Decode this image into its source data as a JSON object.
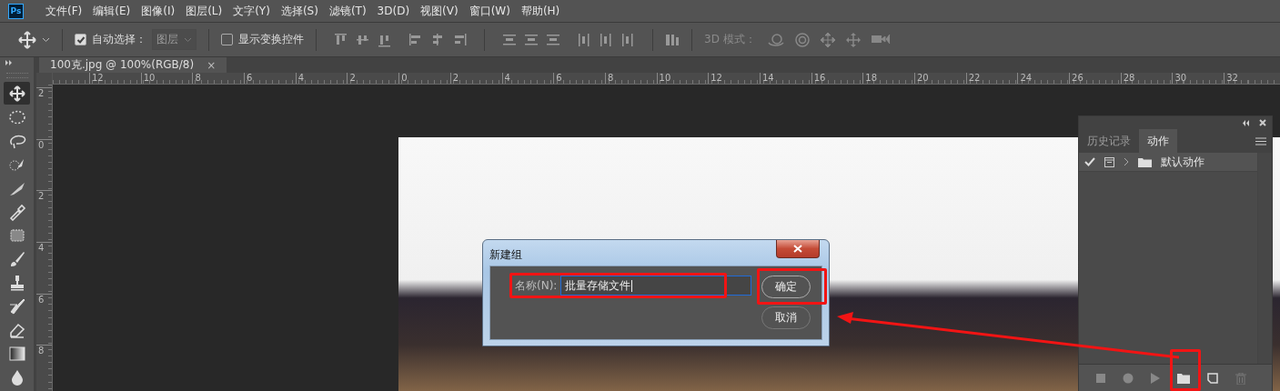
{
  "app_logo": "Ps",
  "menu": [
    "文件(F)",
    "编辑(E)",
    "图像(I)",
    "图层(L)",
    "文字(Y)",
    "选择(S)",
    "滤镜(T)",
    "3D(D)",
    "视图(V)",
    "窗口(W)",
    "帮助(H)"
  ],
  "options_bar": {
    "auto_select": {
      "label": "自动选择：",
      "checked": true
    },
    "target_dropdown": {
      "value": "图层",
      "disabled": true
    },
    "show_transform": {
      "label": "显示变换控件",
      "checked": false
    },
    "mode_label": "3D 模式："
  },
  "document_tab": {
    "title": "100克.jpg @ 100%(RGB/8)",
    "close": "×"
  },
  "tools": [
    {
      "selected": true
    },
    {
      "selected": false
    },
    {
      "selected": false
    },
    {
      "selected": false
    },
    {
      "selected": false
    },
    {
      "selected": false
    },
    {
      "selected": false
    },
    {
      "selected": false
    },
    {
      "selected": false
    },
    {
      "selected": false
    },
    {
      "selected": false
    },
    {
      "selected": false
    },
    {
      "selected": false
    }
  ],
  "rulers": {
    "horizontal": [
      "12",
      "10",
      "8",
      "6",
      "4",
      "2",
      "0",
      "2",
      "4",
      "6",
      "8",
      "10",
      "12",
      "14",
      "16",
      "18",
      "20",
      "22",
      "24",
      "26",
      "28",
      "30",
      "32"
    ],
    "vertical": [
      "2",
      "0",
      "2",
      "4",
      "6",
      "8"
    ]
  },
  "dialog": {
    "title": "新建组",
    "name_label": "名称(N):",
    "name_value": "批量存储文件",
    "buttons": [
      "确定",
      "取消"
    ]
  },
  "actions_panel": {
    "tabs": [
      {
        "label": "历史记录",
        "selected": false
      },
      {
        "label": "动作",
        "selected": true
      }
    ],
    "items": [
      {
        "name": "默认动作",
        "checked": true,
        "expanded": false
      }
    ]
  }
}
